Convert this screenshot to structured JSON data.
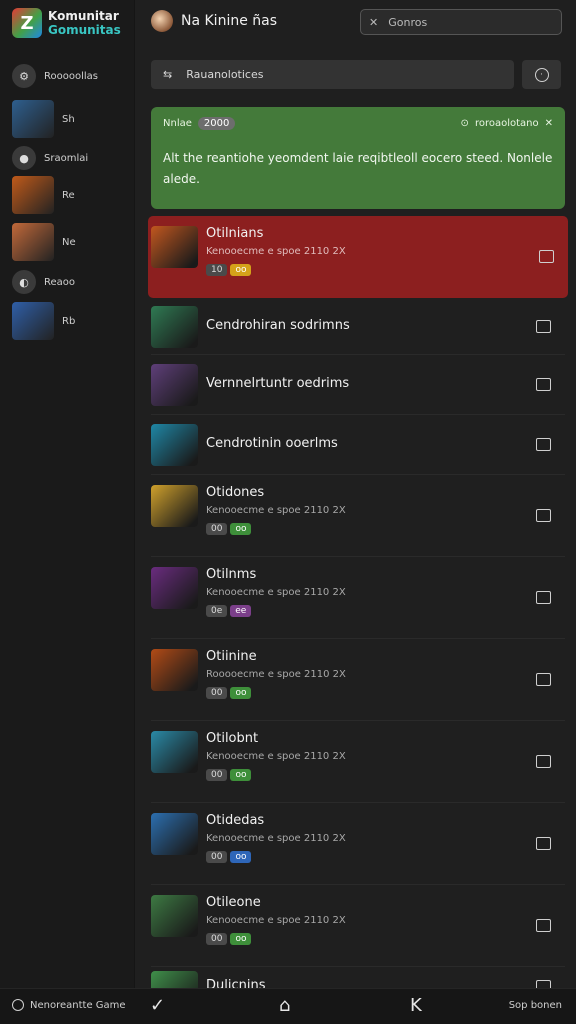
{
  "app": {
    "title": "Komunitar",
    "subtitle": "Gomunitas"
  },
  "profile": {
    "name": "Na Kinine ñas"
  },
  "search": {
    "placeholder": "Gonros"
  },
  "filter": {
    "label": "Rauanolotices"
  },
  "sidebar": {
    "items": [
      {
        "label": "Rooooollas",
        "kind": "pill",
        "icon": "⚙"
      },
      {
        "label": "Sh",
        "kind": "thumb",
        "color": "#2e5f8f"
      },
      {
        "label": "Sraomlai",
        "kind": "pill",
        "icon": "●"
      },
      {
        "label": "Re",
        "kind": "thumb",
        "color": "#c05a1a"
      },
      {
        "label": "Ne",
        "kind": "thumb",
        "color": "#c2693a"
      },
      {
        "label": "Reaoo",
        "kind": "pill",
        "icon": "◐"
      },
      {
        "label": "Rb",
        "kind": "thumb",
        "color": "#2f5fa8"
      }
    ]
  },
  "banner": {
    "lead": "Nnlae",
    "chip": "2000",
    "right": "roroaolotano",
    "body": "Alt the reantiohe yeomdent laie reqibtleoll eocero steed. Nonlele alede."
  },
  "games": [
    {
      "title": "Otilnians",
      "subtitle": "Kenooecme e spoe 2110 2X",
      "tag": "10",
      "badge": "oo",
      "badge_color": "#d4a21a",
      "highlight": true,
      "thumb": "#c2571f"
    },
    {
      "title": "Cendrohiran sodrimns",
      "subtitle": "",
      "tag": "",
      "badge": "",
      "badge_color": "",
      "highlight": false,
      "thumb": "#2f7a53"
    },
    {
      "title": "Vernnelrtuntr oedrims",
      "subtitle": "",
      "tag": "",
      "badge": "",
      "badge_color": "",
      "highlight": false,
      "thumb": "#5f3f7a"
    },
    {
      "title": "Cendrotinin ooerlms",
      "subtitle": "",
      "tag": "",
      "badge": "",
      "badge_color": "",
      "highlight": false,
      "thumb": "#1f87a6"
    },
    {
      "title": "Otidones",
      "subtitle": "Kenooecme e spoe 2110 2X",
      "tag": "00",
      "badge": "oo",
      "badge_color": "#3e8f3a",
      "highlight": false,
      "thumb": "#d0a12c"
    },
    {
      "title": "Otilnms",
      "subtitle": "Kenooecme e spoe 2110 2X",
      "tag": "0e",
      "badge": "ee",
      "badge_color": "#7b3f8a",
      "highlight": false,
      "thumb": "#6a2c7f"
    },
    {
      "title": "Otiinine",
      "subtitle": "Rooooecme e spoe 2110 2X",
      "tag": "00",
      "badge": "oo",
      "badge_color": "#3e8f3a",
      "highlight": false,
      "thumb": "#b24b16"
    },
    {
      "title": "Otilobnt",
      "subtitle": "Kenooecme e spoe 2110 2X",
      "tag": "00",
      "badge": "oo",
      "badge_color": "#3e8f3a",
      "highlight": false,
      "thumb": "#2a8aa7"
    },
    {
      "title": "Otidedas",
      "subtitle": "Kenooecme e spoe 2110 2X",
      "tag": "00",
      "badge": "oo",
      "badge_color": "#2e66b8",
      "highlight": false,
      "thumb": "#2c6fb0"
    },
    {
      "title": "Otileone",
      "subtitle": "Kenooecme e spoe 2110 2X",
      "tag": "00",
      "badge": "oo",
      "badge_color": "#3e8f3a",
      "highlight": false,
      "thumb": "#3d7a43"
    },
    {
      "title": "Dulicnins",
      "subtitle": "",
      "tag": "",
      "badge": "",
      "badge_color": "",
      "highlight": false,
      "thumb": "#3f8f4a"
    }
  ],
  "bottombar": {
    "left_label": "Nenoreantte Game",
    "right_label": "Sop bonen"
  }
}
